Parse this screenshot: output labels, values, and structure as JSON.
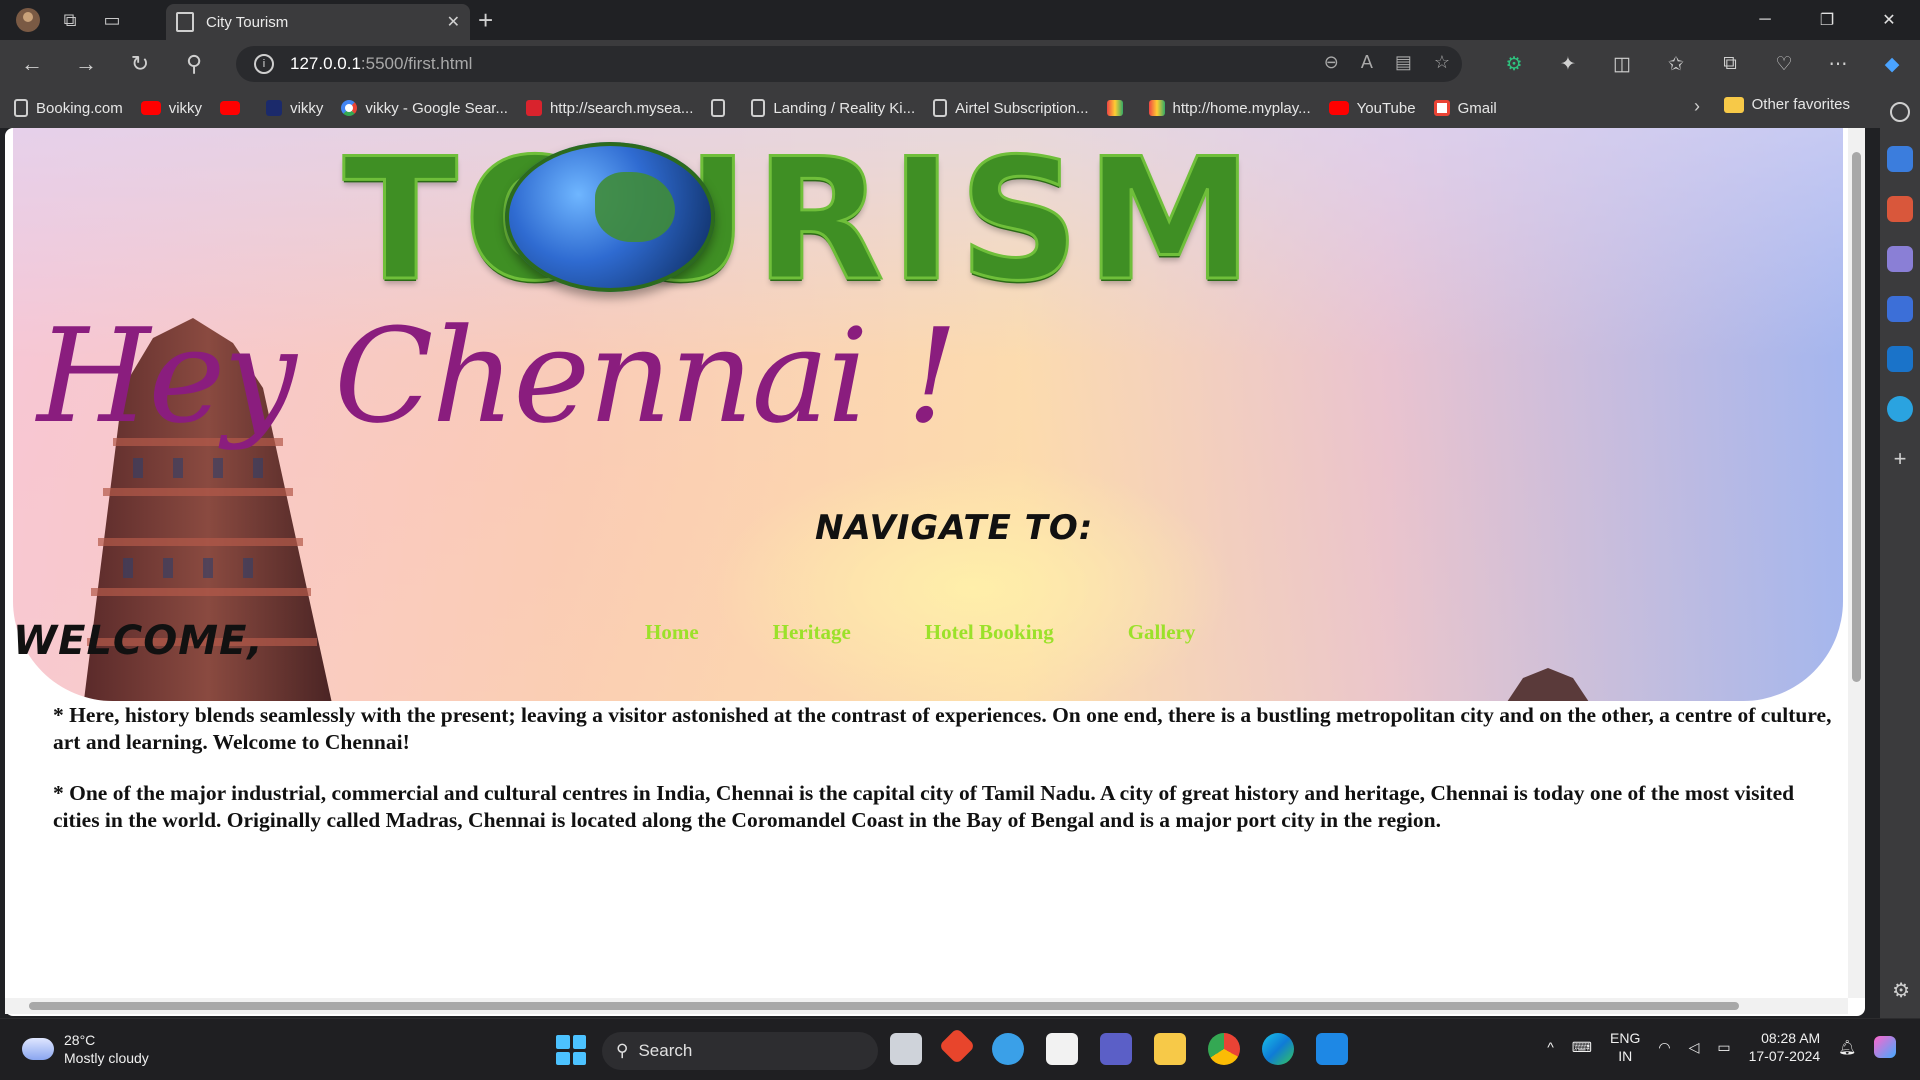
{
  "browser": {
    "tab_title": "City Tourism",
    "address_host": "127.0.0.1",
    "address_path": ":5500/first.html",
    "window_controls": [
      "─",
      "❐",
      "✕"
    ]
  },
  "bookmarks": [
    {
      "label": "Booking.com",
      "icon": "page"
    },
    {
      "label": "vikky",
      "icon": "yt"
    },
    {
      "label": "",
      "icon": "yt"
    },
    {
      "label": "vikky",
      "icon": "app"
    },
    {
      "label": "vikky - Google Sear...",
      "icon": "g"
    },
    {
      "label": "http://search.mysea...",
      "icon": "ask"
    },
    {
      "label": "",
      "icon": "page"
    },
    {
      "label": "Landing / Reality Ki...",
      "icon": "page"
    },
    {
      "label": "Airtel Subscription...",
      "icon": "page"
    },
    {
      "label": "",
      "icon": "books"
    },
    {
      "label": "http://home.myplay...",
      "icon": "books"
    },
    {
      "label": "YouTube",
      "icon": "yt"
    },
    {
      "label": "Gmail",
      "icon": "gmail"
    }
  ],
  "bookmarks_other": "Other favorites",
  "page": {
    "logo_text": "TOURISM",
    "greeting": "Hey Chennai !",
    "navigate_label": "NAVIGATE TO:",
    "nav_links": [
      "Home",
      "Heritage",
      "Hotel Booking",
      "Gallery"
    ],
    "welcome_heading": "WELCOME,",
    "paragraphs": [
      "* Here, history blends seamlessly with the present; leaving a visitor astonished at the contrast of experiences. On one end, there is a bustling metropolitan city and on the other, a centre of culture, art and learning. Welcome to Chennai!",
      "* One of the major industrial, commercial and cultural centres in India, Chennai is the capital city of Tamil Nadu. A city of great history and heritage, Chennai is today one of the most visited cities in the world. Originally called Madras, Chennai is located along the Coromandel Coast in the Bay of Bengal and is a major port city in the region."
    ]
  },
  "taskbar": {
    "temperature": "28°C",
    "weather": "Mostly cloudy",
    "search_label": "Search",
    "lang_top": "ENG",
    "lang_bottom": "IN",
    "time": "08:28 AM",
    "date": "17-07-2024"
  },
  "colors": {
    "nav_link": "#9be12a",
    "greeting": "#8a1d7e",
    "logo_green": "#3f8f24"
  }
}
